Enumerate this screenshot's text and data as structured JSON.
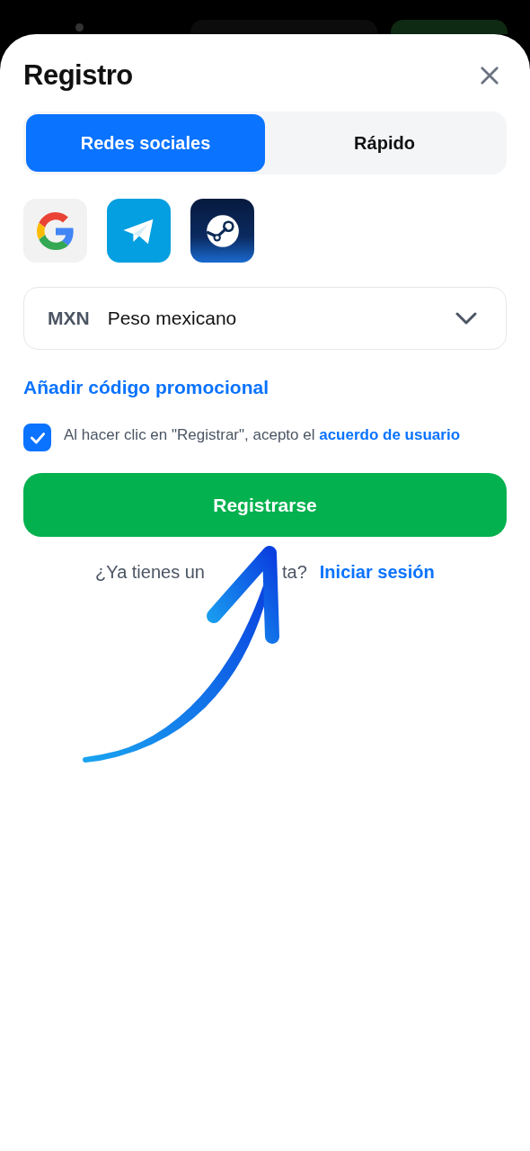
{
  "title": "Registro",
  "tabs": [
    {
      "label": "Redes sociales",
      "selected": true
    },
    {
      "label": "Rápido",
      "selected": false
    }
  ],
  "social": [
    {
      "kind": "google"
    },
    {
      "kind": "telegram"
    },
    {
      "kind": "steam"
    }
  ],
  "currency": {
    "code": "MXN",
    "name": "Peso mexicano"
  },
  "promo_link": "Añadir código promocional",
  "agreement": {
    "checked": true,
    "text": "Al hacer clic en \"Registrar\", acepto el",
    "link": "acuerdo de usuario"
  },
  "submit": "Registrarse",
  "login": {
    "prompt_start": "¿Ya tienes un",
    "prompt_end": "ta?",
    "link": "Iniciar sesión"
  }
}
